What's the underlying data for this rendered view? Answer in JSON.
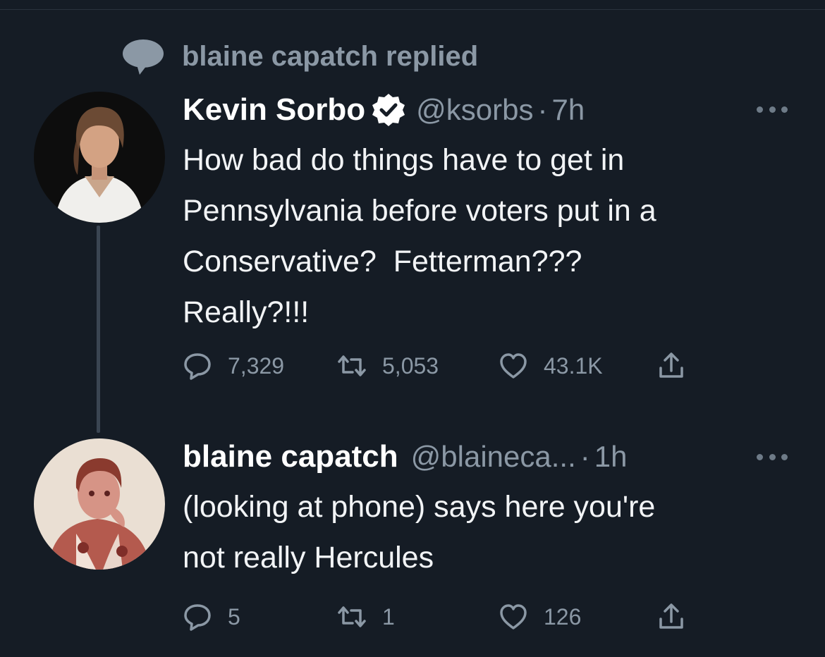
{
  "context": {
    "text": "blaine capatch replied",
    "icon": "speech-bubble-icon"
  },
  "tweets": [
    {
      "name": "Kevin Sorbo",
      "verified": true,
      "handle": "@ksorbs",
      "separator": "·",
      "time": "7h",
      "text": "How bad do things have to get in\nPennsylvania before voters put in a\nConservative?  Fetterman???\nReally?!!!",
      "stats": {
        "replies": "7,329",
        "retweets": "5,053",
        "likes": "43.1K"
      }
    },
    {
      "name": "blaine capatch",
      "verified": false,
      "handle": "@blaineca...",
      "separator": "·",
      "time": "1h",
      "text": "(looking at phone) says here you're\nnot really Hercules",
      "stats": {
        "replies": "5",
        "retweets": "1",
        "likes": "126"
      }
    }
  ],
  "colors": {
    "background": "#151c25",
    "secondary_text": "#8b98a5",
    "primary_text": "#ffffff",
    "thread_line": "#3a4552"
  }
}
